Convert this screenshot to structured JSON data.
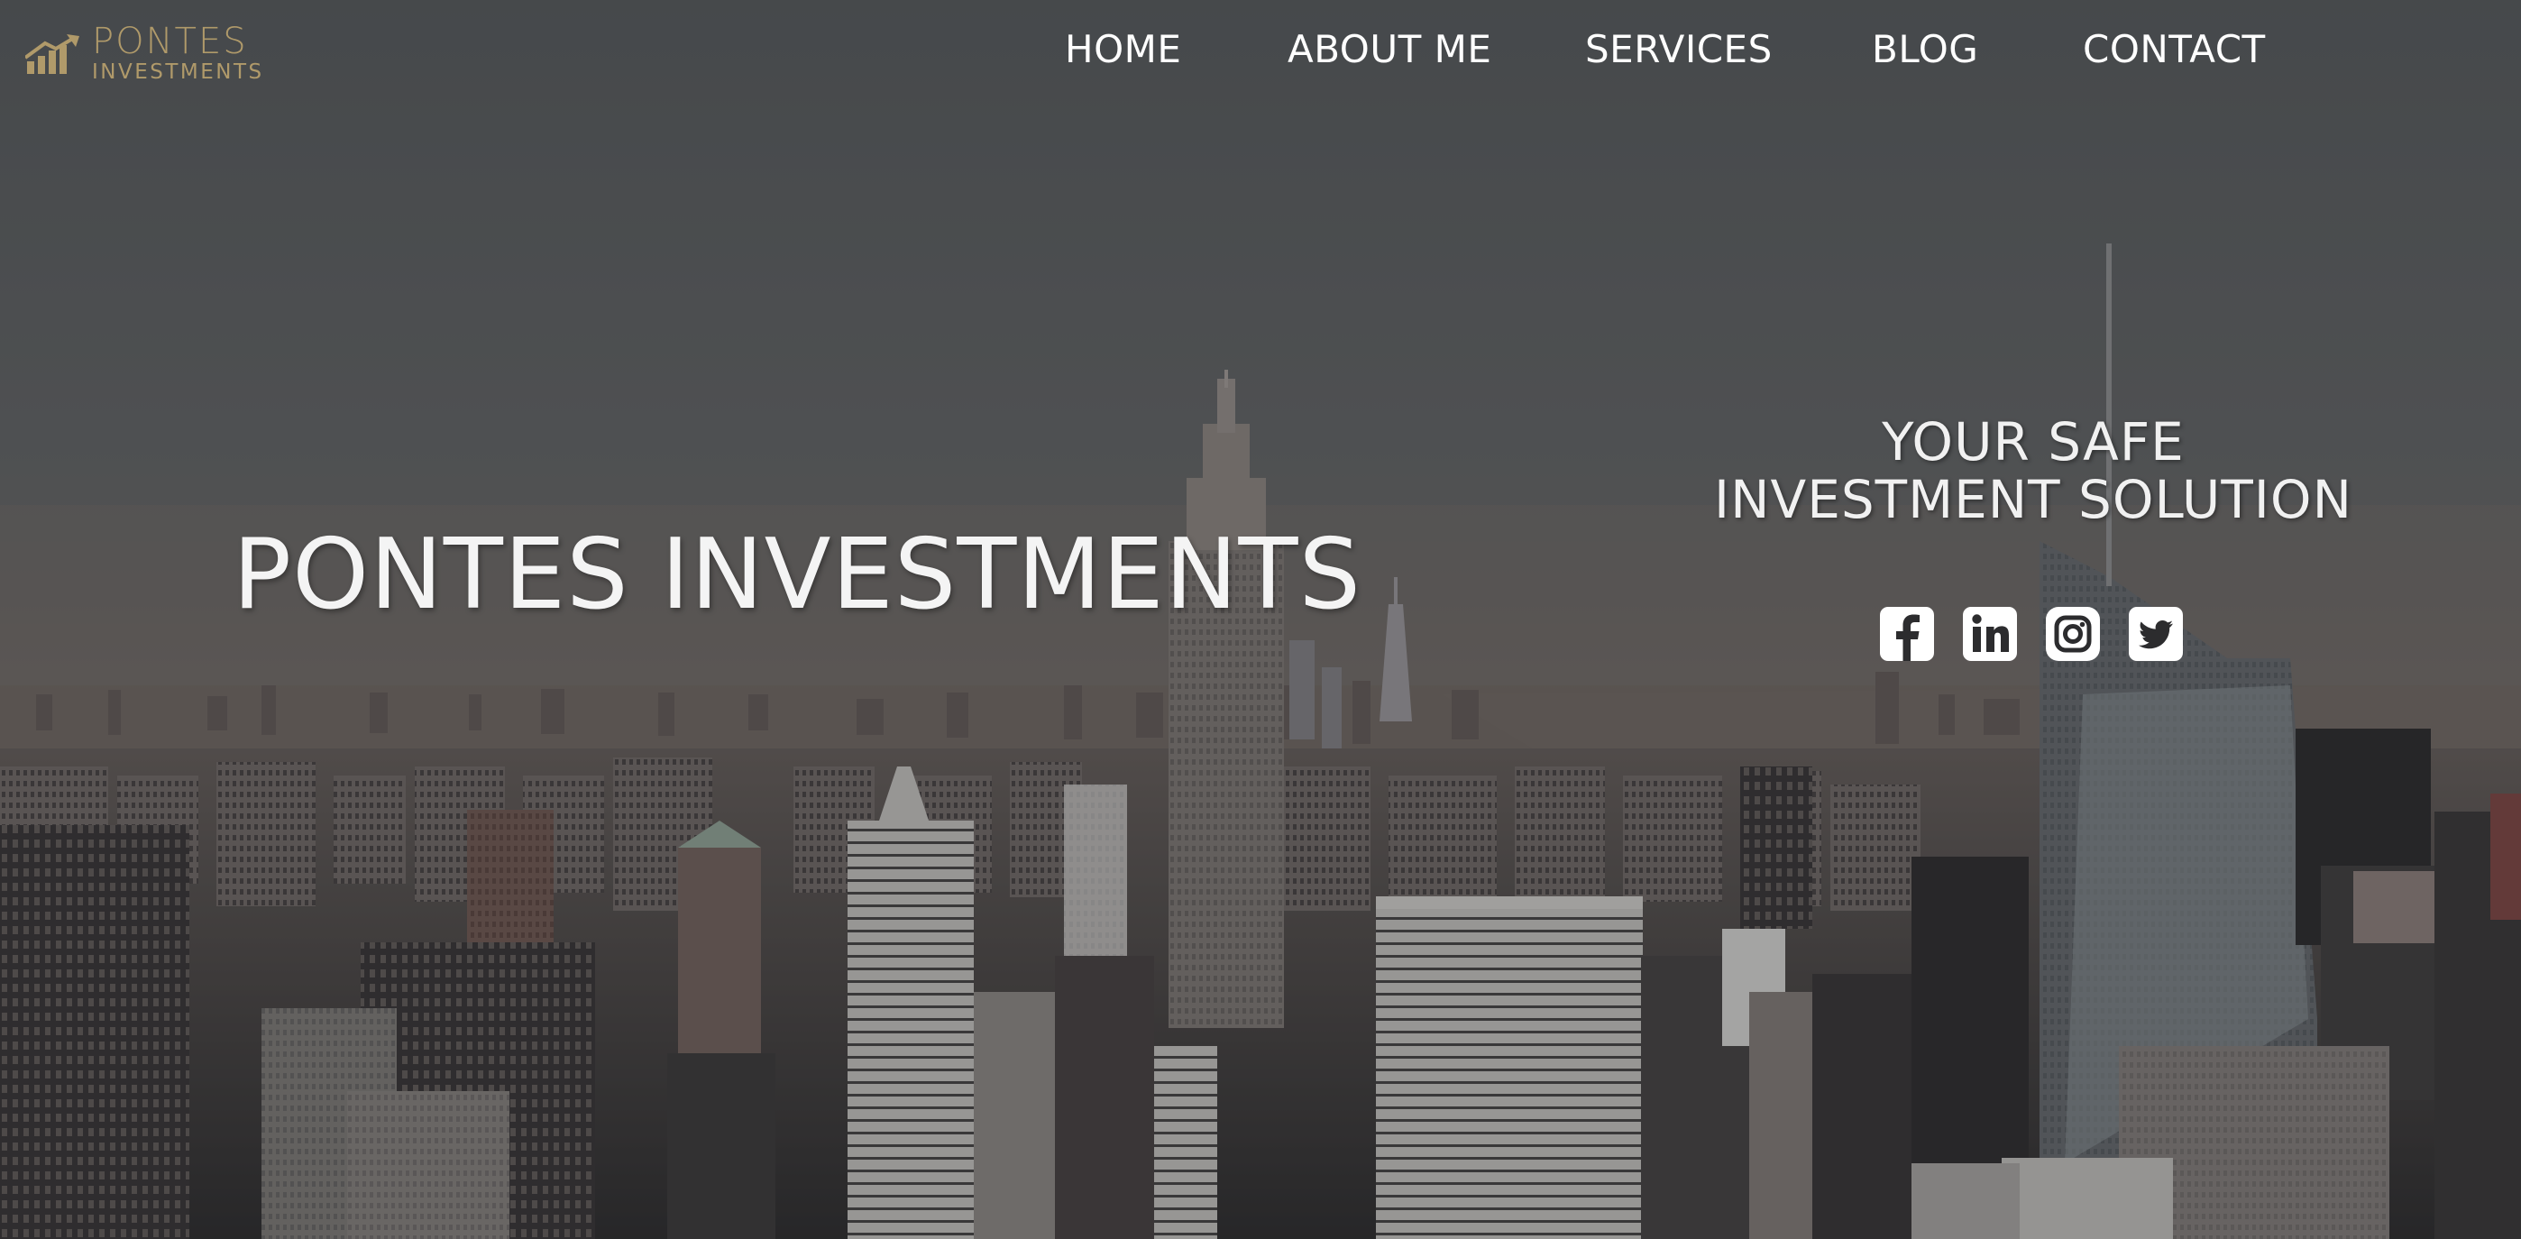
{
  "brand": {
    "logo_line1": "PONTES",
    "logo_line2": "INVESTMENTS",
    "logo_icon": "bar-chart-arrow-icon",
    "logo_color": "#b09a6a"
  },
  "nav": {
    "items": [
      {
        "label": "HOME"
      },
      {
        "label": "ABOUT ME"
      },
      {
        "label": "SERVICES"
      },
      {
        "label": "BLOG"
      },
      {
        "label": "CONTACT"
      }
    ]
  },
  "hero": {
    "title": "PONTES INVESTMENTS",
    "tagline_line1": "YOUR SAFE",
    "tagline_line2": "INVESTMENT SOLUTION",
    "background": "city-skyline-image"
  },
  "social": [
    {
      "icon": "facebook-icon"
    },
    {
      "icon": "linkedin-icon"
    },
    {
      "icon": "instagram-icon"
    },
    {
      "icon": "twitter-icon"
    }
  ],
  "colors": {
    "text": "#ffffff",
    "overlay": "#4a4c4e"
  }
}
